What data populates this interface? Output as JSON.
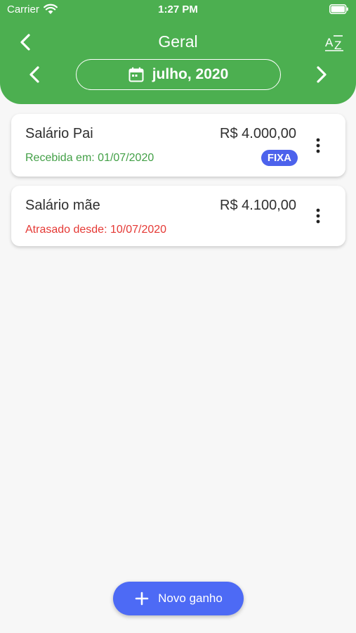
{
  "status_bar": {
    "carrier": "Carrier",
    "time": "1:27 PM"
  },
  "header": {
    "title": "Geral",
    "month_label": "julho, 2020",
    "sort_icon_text": "AZ",
    "background_color": "#4caf50"
  },
  "incomes": [
    {
      "name": "Salário Pai",
      "amount": "R$ 4.000,00",
      "status": "Recebida em: 01/07/2020",
      "status_color": "#43a047",
      "badge": "FIXA"
    },
    {
      "name": "Salário mãe",
      "amount": "R$ 4.100,00",
      "status": "Atrasado desde: 10/07/2020",
      "status_color": "#e53935"
    }
  ],
  "fab": {
    "label": "Novo ganho",
    "color": "#4d6af5"
  },
  "icons": [
    "wifi-icon",
    "battery-icon",
    "back-arrow-icon",
    "sort-az-icon",
    "chevron-left-icon",
    "chevron-right-icon",
    "calendar-icon",
    "more-vertical-icon",
    "plus-icon"
  ]
}
